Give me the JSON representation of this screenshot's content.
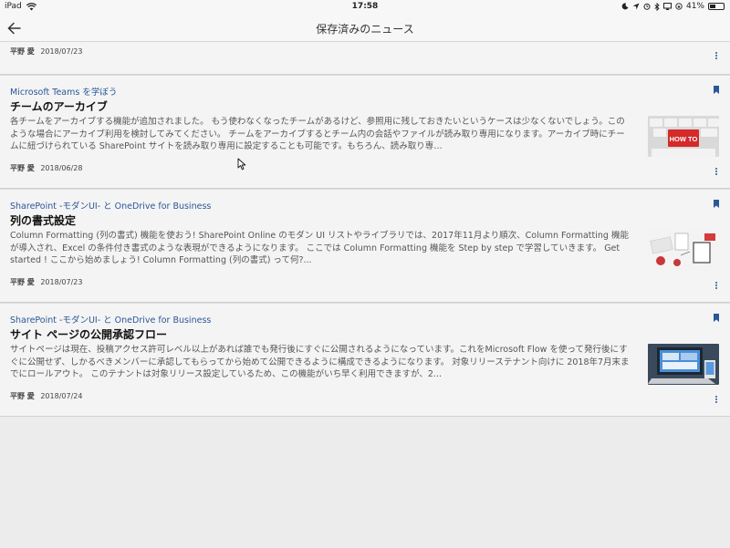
{
  "status": {
    "device": "iPad",
    "time": "17:58",
    "battery": "41%"
  },
  "nav": {
    "title": "保存済みのニュース"
  },
  "partial_item": {
    "author": "平野 愛",
    "date": "2018/07/23"
  },
  "items": [
    {
      "category": "Microsoft Teams を学ぼう",
      "title": "チームのアーカイブ",
      "summary": "各チームをアーカイブする機能が追加されました。 もう使わなくなったチームがあるけど、参照用に残しておきたいというケースは少なくないでしょう。このような場合にアーカイブ利用を検討してみてください。 チームをアーカイブするとチーム内の会話やファイルが読み取り専用になります。アーカイブ時にチームに紐づけられている SharePoint サイトを読み取り専用に設定することも可能です。もちろん、読み取り専…",
      "author": "平野 愛",
      "date": "2018/06/28",
      "thumb_text": "HOW TO"
    },
    {
      "category": "SharePoint -モダンUI- と OneDrive for Business",
      "title": "列の書式設定",
      "summary": "Column Formatting (列の書式) 機能を使おう! SharePoint Online のモダン UI リストやライブラリでは、2017年11月より順次、Column Formatting 機能が導入され、Excel の条件付き書式のような表現ができるようになります。 ここでは Column Formatting 機能を Step by step で学習していきます。 Get started ! ここから始めましょう! Column Formatting (列の書式) って何?...",
      "author": "平野 愛",
      "date": "2018/07/23"
    },
    {
      "category": "SharePoint -モダンUI- と OneDrive for Business",
      "title": "サイト ページの公開承認フロー",
      "summary": "サイトページは現在、投稿アクセス許可レベル以上があれば誰でも発行後にすぐに公開されるようになっています。これをMicrosoft Flow を使って発行後にすぐに公開せず、しかるべきメンバーに承認してもらってから始めて公開できるように構成できるようになります。 対象リリーステナント向けに 2018年7月末までにロールアウト。 このテナントは対象リリース設定しているため、この機能がいち早く利用できますが、2...",
      "author": "平野 愛",
      "date": "2018/07/24"
    }
  ],
  "colors": {
    "accent": "#2b5797",
    "background": "#ececec",
    "card": "#f4f4f4"
  },
  "icons": {
    "back": "arrow-left-icon",
    "more": "more-vertical-icon",
    "bookmark": "bookmark-icon"
  }
}
